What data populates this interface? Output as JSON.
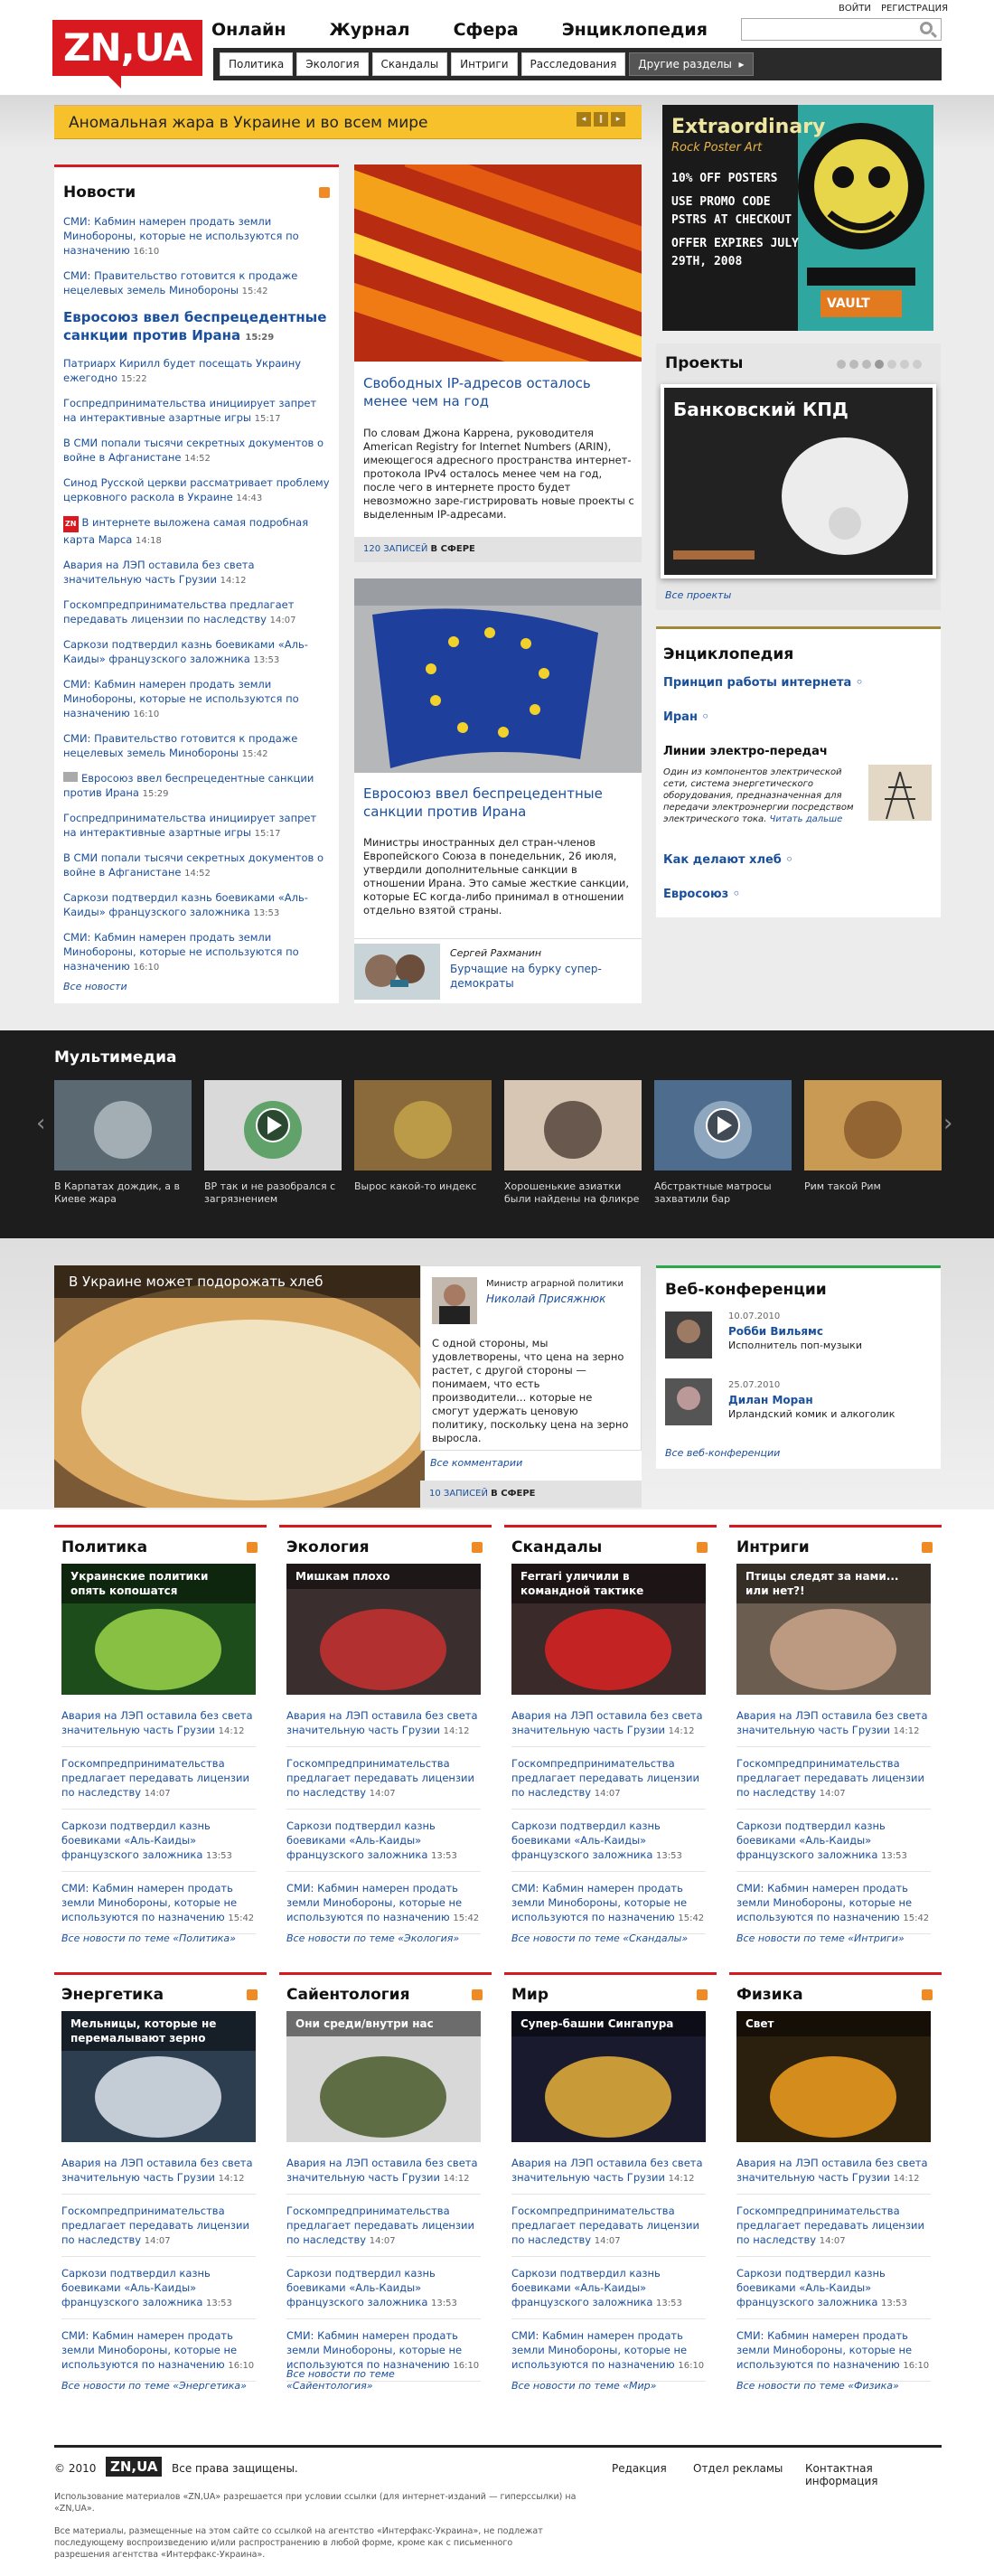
{
  "logo": "ZN,UA",
  "nav": [
    "Онлайн",
    "Журнал",
    "Сфера",
    "Энциклопедия"
  ],
  "top_links": {
    "login": "ВОЙТИ",
    "register": "РЕГИСТРАЦИЯ"
  },
  "subnav": [
    "Политика",
    "Экология",
    "Скандалы",
    "Интриги",
    "Расследования"
  ],
  "subnav_more": "Другие разделы",
  "ticker": "Аномальная жара в Украине и во всем мире",
  "ad": {
    "l1": "Extraordinary",
    "l2": "Rock Poster Art",
    "l3": "10% OFF POSTERS",
    "l4": "USE PROMO CODE",
    "l5": "PSTRS AT CHECKOUT",
    "l6": "OFFER EXPIRES JULY",
    "l7": "29TH, 2008",
    "brand": "VAULT"
  },
  "news": {
    "title": "Новости",
    "items": [
      {
        "text": "СМИ: Кабмин намерен продать земли Минобороны, которые не используются по назначению",
        "time": "16:10"
      },
      {
        "text": "СМИ: Правительство готовится к продаже нецелевых земель Минобороны",
        "time": "15:42"
      },
      {
        "text": "Евросоюз ввел беспрецедентные санкции против Ирана",
        "time": "15:29",
        "big": true
      },
      {
        "text": "Патриарх Кирилл будет посещать Украину ежегодно",
        "time": "15:22"
      },
      {
        "text": "Госпредпринимательства инициирует запрет на интерактивные азартные игры",
        "time": "15:17"
      },
      {
        "text": "В СМИ попали тысячи секретных документов о войне в Афганистане",
        "time": "14:52"
      },
      {
        "text": "Синод Русской церкви рассматривает проблему церковного раскола в Украине",
        "time": "14:43"
      },
      {
        "text": "В интернете выложена самая подробная карта Марса",
        "time": "14:18",
        "badge": "ZN"
      },
      {
        "text": "Авария на ЛЭП оставила без света значительную часть Грузии",
        "time": "14:12"
      },
      {
        "text": "Госкомпредпринимательства предлагает передавать лицензии по наследству",
        "time": "14:07"
      },
      {
        "text": "Саркози подтвердил казнь боевиками «Аль-Каиды» французского заложника",
        "time": "13:53"
      },
      {
        "text": "СМИ: Кабмин намерен продать земли Минобороны, которые не используются по назначению",
        "time": "16:10"
      },
      {
        "text": "СМИ: Правительство готовится к продаже нецелевых земель Минобороны",
        "time": "15:42"
      },
      {
        "text": "Евросоюз ввел беспрецедентные санкции против Ирана",
        "time": "15:29",
        "badge": "img"
      },
      {
        "text": "Госпредпринимательства инициирует запрет на интерактивные азартные игры",
        "time": "15:17"
      },
      {
        "text": "В СМИ попали тысячи секретных документов о войне в Афганистане",
        "time": "14:52"
      },
      {
        "text": "Саркози подтвердил казнь боевиками «Аль-Каиды» французского заложника",
        "time": "13:53"
      },
      {
        "text": "СМИ: Кабмин намерен продать земли Минобороны, которые не используются по назначению",
        "time": "16:10"
      }
    ],
    "all": "Все новости"
  },
  "story1": {
    "title": "Свободных IP-адресов осталось менее чем на год",
    "body": "По словам Джона Каррена, руководителя American Registry for Internet Numbers (ARIN), имеющегося адресного пространства интернет-протокола IPv4 осталось менее чем на год, после чего в интернете просто будет невозможно заре-гистрировать новые проекты с выделенным IP-адресами.",
    "count": "120 ЗАПИСЕЙ",
    "sphere": "В СФЕРЕ"
  },
  "story2": {
    "title": "Евросоюз ввел беспрецедентные санкции против Ирана",
    "body": "Министры иностранных дел стран-членов Европейского Союза в понедельник, 26 июля, утвердили дополнительные санкции в отношении Ирана. Это самые жесткие санкции, которые ЕС когда-либо принимал в отношении отдельно взятой страны.",
    "author": "Сергей Рахманин",
    "link": "Бурчащие на бурку супер-демократы"
  },
  "projects": {
    "title": "Проекты",
    "banner": "Банковский КПД",
    "all": "Все проекты"
  },
  "encyclopedia": {
    "title": "Энциклопедия",
    "items": [
      "Принцип работы интернета",
      "Иран"
    ],
    "feature": "Линии электро-передач",
    "desc": "Один из компонентов электрической сети, система энергетического оборудования, предназначенная для передачи электроэнергии посредством электрического тока.",
    "more": "Читать дальше",
    "items2": [
      "Как делают хлеб",
      "Евросоюз"
    ]
  },
  "multimedia": {
    "title": "Мультимедиа",
    "items": [
      "В Карпатах дождик, а в Киеве жара",
      "BP так и не разобрался с загрязнением",
      "Вырос какой-то индекс",
      "Хорошенькие азиатки были найдены на фликре",
      "Абстрактные матросы захватили бар",
      "Рим такой Рим"
    ]
  },
  "bread": {
    "headline": "В Украине может подорожать хлеб",
    "role": "Министр аграрной политики",
    "name": "Николай Присяжнюк",
    "quote": "С одной стороны, мы удовлетворены, что цена на зерно растет, с другой стороны — понимаем, что есть производители... которые не смогут удержать ценовую политику, поскольку цена на зерно выросла.",
    "comments": "Все комментарии",
    "count": "10 ЗАПИСЕЙ",
    "sphere": "В СФЕРЕ"
  },
  "webconf": {
    "title": "Веб-конференции",
    "items": [
      {
        "date": "10.07.2010",
        "name": "Робби Вильямс",
        "role": "Исполнитель поп-музыки"
      },
      {
        "date": "25.07.2010",
        "name": "Дилан Моран",
        "role": "Ирландский комик и алкоголик"
      }
    ],
    "all": "Все веб-конференции"
  },
  "cards": [
    {
      "title": "Политика",
      "caption": "Украинские политики опять копошатся",
      "all": "Все новости по теме «Политика»"
    },
    {
      "title": "Экология",
      "caption": "Мишкам плохо",
      "all": "Все новости по теме «Экология»"
    },
    {
      "title": "Скандалы",
      "caption": "Ferrari уличили в командной тактике",
      "all": "Все новости по теме «Скандалы»"
    },
    {
      "title": "Интриги",
      "caption": "Птицы следят за нами... или нет?!",
      "all": "Все новости по теме «Интриги»"
    },
    {
      "title": "Энергетика",
      "caption": "Мельницы, которые не перемалывают зерно",
      "all": "Все новости по теме «Энергетика»"
    },
    {
      "title": "Сайентология",
      "caption": "Они среди/внутри нас",
      "all": "Все новости по теме «Сайентология»"
    },
    {
      "title": "Мир",
      "caption": "Супер-башни Сингапура",
      "all": "Все новости по теме «Мир»"
    },
    {
      "title": "Физика",
      "caption": "Свет",
      "all": "Все новости по теме «Физика»"
    }
  ],
  "card_items": [
    {
      "text": "Авария на ЛЭП оставила без света значительную часть Грузии",
      "time": "14:12"
    },
    {
      "text": "Госкомпредпринимательства предлагает передавать лицензии по наследству",
      "time": "14:07"
    },
    {
      "text": "Саркози подтвердил казнь боевиками «Аль-Каиды» французского заложника",
      "time": "13:53"
    },
    {
      "text": "СМИ: Кабмин намерен продать земли Минобороны, которые не используются по назначению",
      "time": "15:42"
    }
  ],
  "card_items_b": [
    {
      "text": "Авария на ЛЭП оставила без света значительную часть Грузии",
      "time": "14:12"
    },
    {
      "text": "Госкомпредпринимательства предлагает передавать лицензии по наследству",
      "time": "14:07"
    },
    {
      "text": "Саркози подтвердил казнь боевиками «Аль-Каиды» французского заложника",
      "time": "13:53"
    },
    {
      "text": "СМИ: Кабмин намерен продать земли Минобороны, которые не используются по назначению",
      "time": "16:10"
    }
  ],
  "footer": {
    "copy": "© 2010",
    "logo": "ZN,UA",
    "rights": "Все права защищены.",
    "links": [
      "Редакция",
      "Отдел рекламы",
      "Контактная информация"
    ],
    "p1": "Использование материалов «ZN,UA» разрешается при условии ссылки (для интернет-изданий — гиперссылки) на «ZN,UA».",
    "p2": "Все материалы, размещенные на этом сайте со ссылкой на агентство «Интерфакс-Украина», не подлежат последующему воспроизведению и/или распространению в любой форме, кроме как с письменного разрешения агентства «Интерфакс-Украина»."
  }
}
